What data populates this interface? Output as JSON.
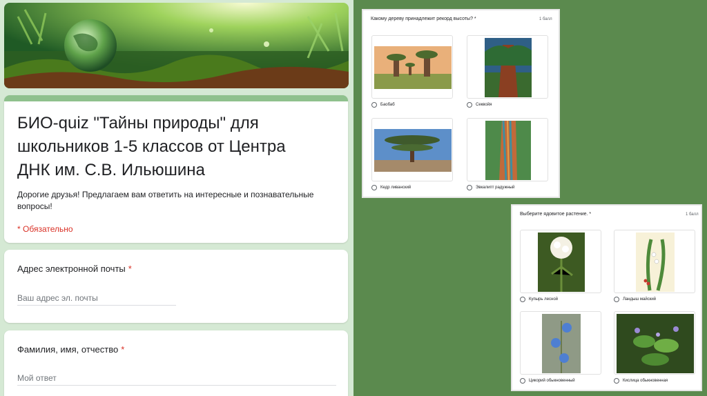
{
  "form": {
    "title": "БИО-quiz \"Тайны природы\" для школьников 1-5 классов от Центра ДНК им. С.В. Ильюшина",
    "description": "Дорогие друзья! Предлагаем вам ответить на интересные и познавательные вопросы!",
    "required_note": "* Обязательно",
    "accent_color": "#8fc18d",
    "questions": [
      {
        "label": "Адрес электронной почты",
        "required_mark": "*",
        "placeholder": "Ваш адрес эл. почты"
      },
      {
        "label": "Фамилия, имя, отчество",
        "required_mark": "*",
        "placeholder": "Мой ответ"
      }
    ]
  },
  "quiz1": {
    "question": "Какому дереву принадлежит рекорд высоты? *",
    "points": "1 балл",
    "options": [
      "Баобаб",
      "Секвойя",
      "Кедр ливанский",
      "Эвкалипт радужный"
    ]
  },
  "quiz2": {
    "question": "Выберите ядовитое растение. *",
    "points": "1 балл",
    "options": [
      "Купырь лесной",
      "Ландыш майский",
      "Цикорий обыкновенный",
      "Кислица обыкновенная"
    ]
  },
  "colors": {
    "required": "#d93025",
    "background_green": "#5b8a4e",
    "form_bg": "#d5e9d4"
  }
}
